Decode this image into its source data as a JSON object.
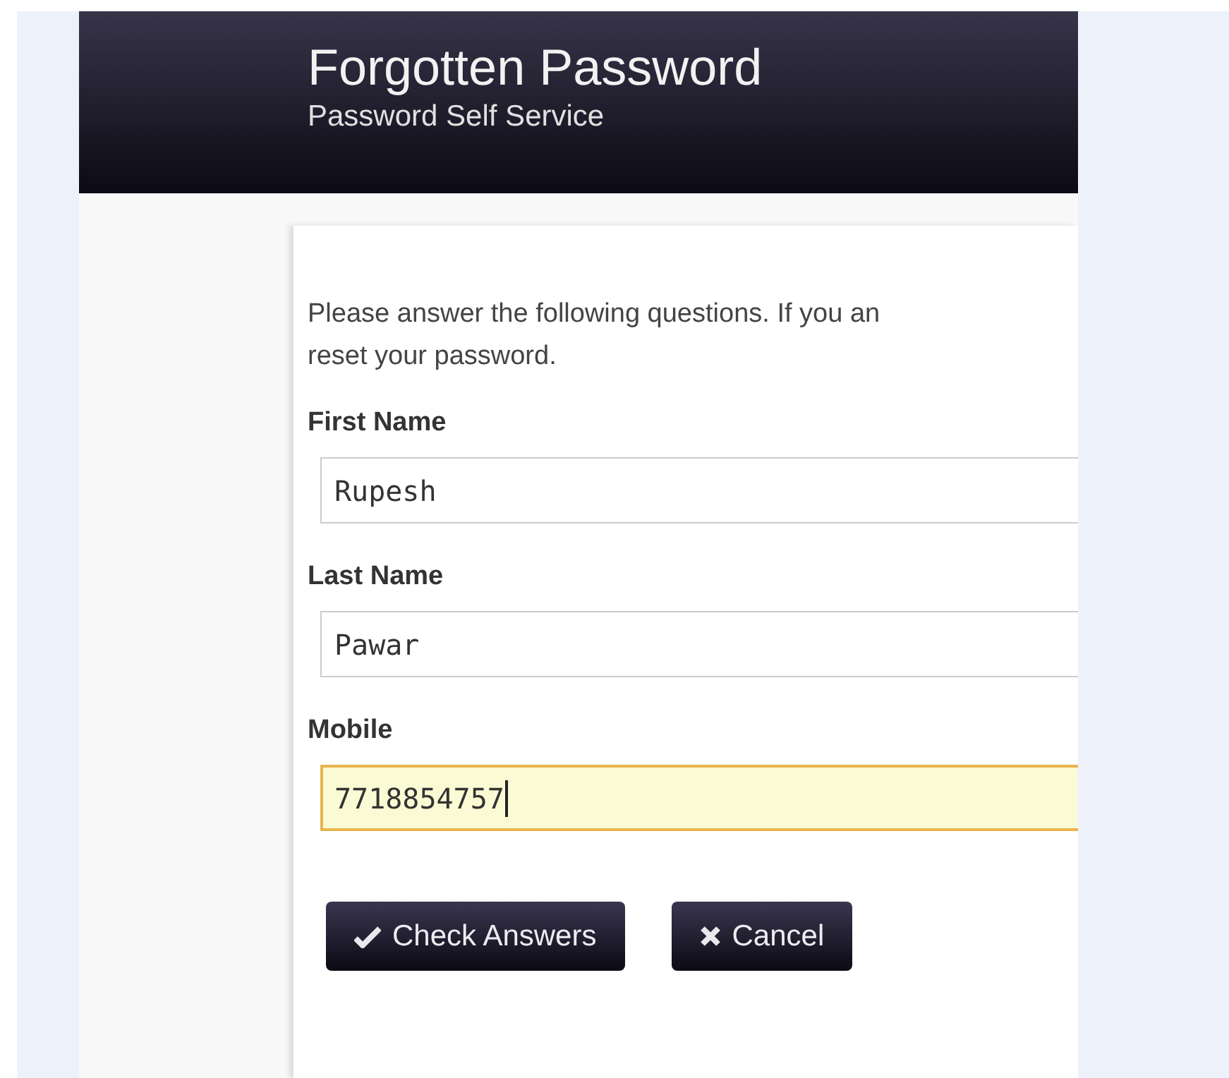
{
  "header": {
    "title": "Forgotten Password",
    "subtitle": "Password Self Service"
  },
  "form": {
    "intro": "Please answer the following questions. If you an\nreset your password.",
    "fields": [
      {
        "label": "First Name",
        "value": "Rupesh",
        "focused": false
      },
      {
        "label": "Last Name",
        "value": "Pawar",
        "focused": false
      },
      {
        "label": "Mobile",
        "value": "7718854757",
        "focused": true
      }
    ],
    "buttons": [
      {
        "kind": "check",
        "label": "Check Answers"
      },
      {
        "kind": "cancel",
        "label": "Cancel"
      }
    ]
  }
}
